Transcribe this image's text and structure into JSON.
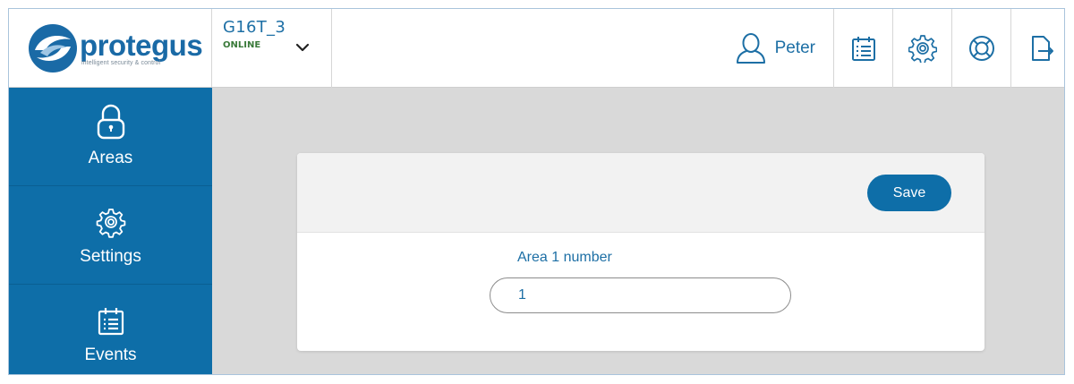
{
  "brand": {
    "name": "protegus",
    "tagline": "intelligent security & control",
    "color": "#1a6aa6"
  },
  "device": {
    "name": "G16T_3",
    "status": "ONLINE",
    "status_color": "#3a7a3a"
  },
  "user": {
    "name": "Peter",
    "icon": "user-icon"
  },
  "toolbar": {
    "buttons": [
      {
        "icon": "events-list-icon"
      },
      {
        "icon": "gear-icon"
      },
      {
        "icon": "lifebuoy-help-icon"
      },
      {
        "icon": "logout-icon"
      }
    ]
  },
  "sidebar": {
    "background": "#0e6ea8",
    "items": [
      {
        "label": "Areas",
        "icon": "lock-icon"
      },
      {
        "label": "Settings",
        "icon": "gear-icon"
      },
      {
        "label": "Events",
        "icon": "calendar-list-icon"
      }
    ]
  },
  "form": {
    "save_label": "Save",
    "field_label": "Area 1 number",
    "field_value": "1"
  }
}
